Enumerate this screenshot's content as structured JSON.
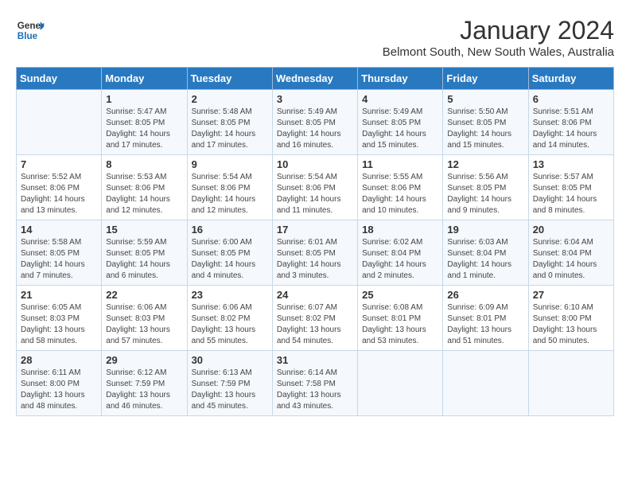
{
  "logo": {
    "line1": "General",
    "line2": "Blue"
  },
  "title": "January 2024",
  "subtitle": "Belmont South, New South Wales, Australia",
  "days_header": [
    "Sunday",
    "Monday",
    "Tuesday",
    "Wednesday",
    "Thursday",
    "Friday",
    "Saturday"
  ],
  "weeks": [
    [
      {
        "day": "",
        "info": ""
      },
      {
        "day": "1",
        "info": "Sunrise: 5:47 AM\nSunset: 8:05 PM\nDaylight: 14 hours\nand 17 minutes."
      },
      {
        "day": "2",
        "info": "Sunrise: 5:48 AM\nSunset: 8:05 PM\nDaylight: 14 hours\nand 17 minutes."
      },
      {
        "day": "3",
        "info": "Sunrise: 5:49 AM\nSunset: 8:05 PM\nDaylight: 14 hours\nand 16 minutes."
      },
      {
        "day": "4",
        "info": "Sunrise: 5:49 AM\nSunset: 8:05 PM\nDaylight: 14 hours\nand 15 minutes."
      },
      {
        "day": "5",
        "info": "Sunrise: 5:50 AM\nSunset: 8:05 PM\nDaylight: 14 hours\nand 15 minutes."
      },
      {
        "day": "6",
        "info": "Sunrise: 5:51 AM\nSunset: 8:06 PM\nDaylight: 14 hours\nand 14 minutes."
      }
    ],
    [
      {
        "day": "7",
        "info": "Sunrise: 5:52 AM\nSunset: 8:06 PM\nDaylight: 14 hours\nand 13 minutes."
      },
      {
        "day": "8",
        "info": "Sunrise: 5:53 AM\nSunset: 8:06 PM\nDaylight: 14 hours\nand 12 minutes."
      },
      {
        "day": "9",
        "info": "Sunrise: 5:54 AM\nSunset: 8:06 PM\nDaylight: 14 hours\nand 12 minutes."
      },
      {
        "day": "10",
        "info": "Sunrise: 5:54 AM\nSunset: 8:06 PM\nDaylight: 14 hours\nand 11 minutes."
      },
      {
        "day": "11",
        "info": "Sunrise: 5:55 AM\nSunset: 8:06 PM\nDaylight: 14 hours\nand 10 minutes."
      },
      {
        "day": "12",
        "info": "Sunrise: 5:56 AM\nSunset: 8:05 PM\nDaylight: 14 hours\nand 9 minutes."
      },
      {
        "day": "13",
        "info": "Sunrise: 5:57 AM\nSunset: 8:05 PM\nDaylight: 14 hours\nand 8 minutes."
      }
    ],
    [
      {
        "day": "14",
        "info": "Sunrise: 5:58 AM\nSunset: 8:05 PM\nDaylight: 14 hours\nand 7 minutes."
      },
      {
        "day": "15",
        "info": "Sunrise: 5:59 AM\nSunset: 8:05 PM\nDaylight: 14 hours\nand 6 minutes."
      },
      {
        "day": "16",
        "info": "Sunrise: 6:00 AM\nSunset: 8:05 PM\nDaylight: 14 hours\nand 4 minutes."
      },
      {
        "day": "17",
        "info": "Sunrise: 6:01 AM\nSunset: 8:05 PM\nDaylight: 14 hours\nand 3 minutes."
      },
      {
        "day": "18",
        "info": "Sunrise: 6:02 AM\nSunset: 8:04 PM\nDaylight: 14 hours\nand 2 minutes."
      },
      {
        "day": "19",
        "info": "Sunrise: 6:03 AM\nSunset: 8:04 PM\nDaylight: 14 hours\nand 1 minute."
      },
      {
        "day": "20",
        "info": "Sunrise: 6:04 AM\nSunset: 8:04 PM\nDaylight: 14 hours\nand 0 minutes."
      }
    ],
    [
      {
        "day": "21",
        "info": "Sunrise: 6:05 AM\nSunset: 8:03 PM\nDaylight: 13 hours\nand 58 minutes."
      },
      {
        "day": "22",
        "info": "Sunrise: 6:06 AM\nSunset: 8:03 PM\nDaylight: 13 hours\nand 57 minutes."
      },
      {
        "day": "23",
        "info": "Sunrise: 6:06 AM\nSunset: 8:02 PM\nDaylight: 13 hours\nand 55 minutes."
      },
      {
        "day": "24",
        "info": "Sunrise: 6:07 AM\nSunset: 8:02 PM\nDaylight: 13 hours\nand 54 minutes."
      },
      {
        "day": "25",
        "info": "Sunrise: 6:08 AM\nSunset: 8:01 PM\nDaylight: 13 hours\nand 53 minutes."
      },
      {
        "day": "26",
        "info": "Sunrise: 6:09 AM\nSunset: 8:01 PM\nDaylight: 13 hours\nand 51 minutes."
      },
      {
        "day": "27",
        "info": "Sunrise: 6:10 AM\nSunset: 8:00 PM\nDaylight: 13 hours\nand 50 minutes."
      }
    ],
    [
      {
        "day": "28",
        "info": "Sunrise: 6:11 AM\nSunset: 8:00 PM\nDaylight: 13 hours\nand 48 minutes."
      },
      {
        "day": "29",
        "info": "Sunrise: 6:12 AM\nSunset: 7:59 PM\nDaylight: 13 hours\nand 46 minutes."
      },
      {
        "day": "30",
        "info": "Sunrise: 6:13 AM\nSunset: 7:59 PM\nDaylight: 13 hours\nand 45 minutes."
      },
      {
        "day": "31",
        "info": "Sunrise: 6:14 AM\nSunset: 7:58 PM\nDaylight: 13 hours\nand 43 minutes."
      },
      {
        "day": "",
        "info": ""
      },
      {
        "day": "",
        "info": ""
      },
      {
        "day": "",
        "info": ""
      }
    ]
  ]
}
